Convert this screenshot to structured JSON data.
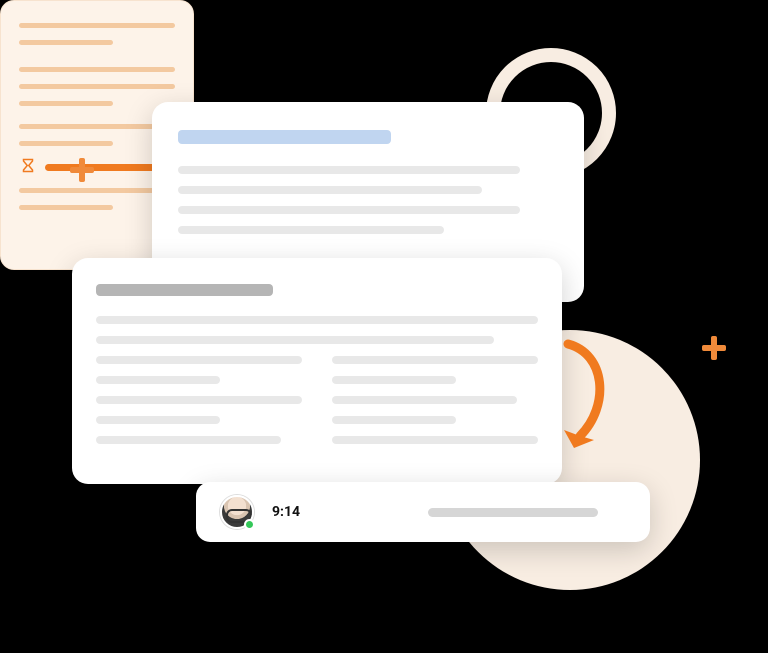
{
  "illustration": {
    "time_label": "9:14",
    "colors": {
      "accent_orange": "#f07a1f",
      "soft_orange": "#f3c9a0",
      "bg_peach": "#f8ede2",
      "line_gray": "#e8e8e8",
      "title_blue": "#c0d5f0"
    }
  }
}
